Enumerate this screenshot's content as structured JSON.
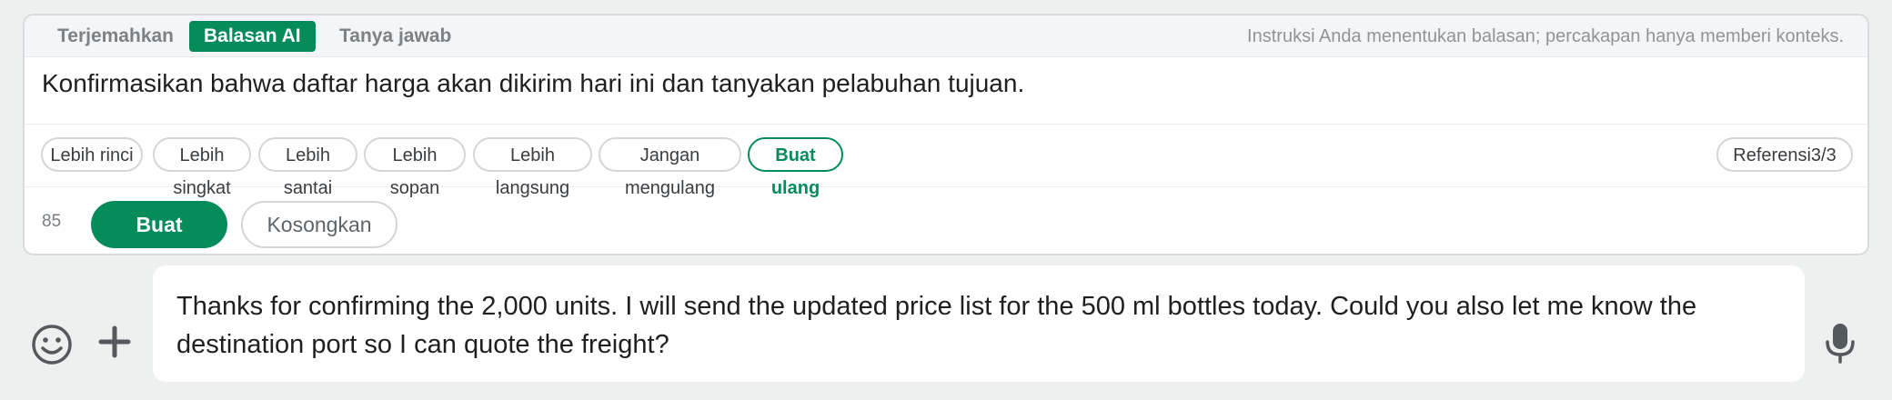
{
  "tabs": [
    {
      "label": "Terjemahkan"
    },
    {
      "label": "Balasan AI"
    },
    {
      "label": "Tanya jawab"
    }
  ],
  "hint": "Instruksi Anda menentukan balasan; percakapan hanya memberi konteks.",
  "instruction": "Konfirmasikan bahwa daftar harga akan dikirim hari ini dan tanyakan pelabuhan tujuan.",
  "chips": [
    {
      "label": "Lebih rinci"
    },
    {
      "label": "Lebih singkat"
    },
    {
      "label": "Lebih santai"
    },
    {
      "label": "Lebih sopan"
    },
    {
      "label": "Lebih langsung"
    },
    {
      "label": "Jangan mengulang"
    },
    {
      "label": "Buat ulang"
    }
  ],
  "reference": "Referensi3/3",
  "char_count": "85",
  "buttons": {
    "generate": "Buat",
    "clear": "Kosongkan"
  },
  "composer_text": "Thanks for confirming the 2,000 units. I will send the updated price list for the 500 ml bottles today. Could you also let me know the destination port so I can quote the freight?",
  "icons": {
    "emoji": "emoji-icon",
    "add": "plus-icon",
    "mic": "microphone-icon"
  },
  "colors": {
    "accent": "#068b5c",
    "background": "#eeefef"
  }
}
